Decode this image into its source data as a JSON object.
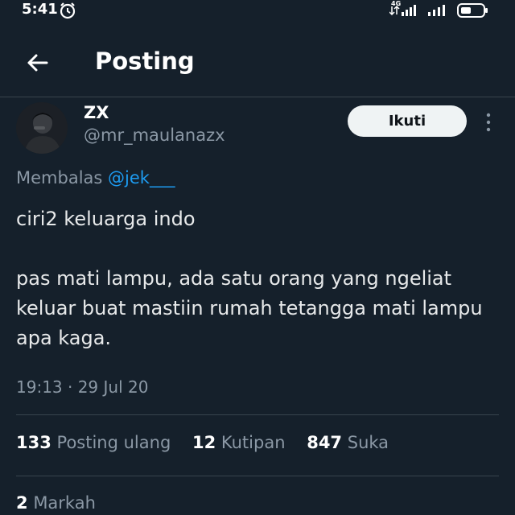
{
  "status_bar": {
    "time": "5:41",
    "network": "4G",
    "icons": [
      "alarm-icon",
      "signal-icon",
      "signal-icon",
      "battery-icon"
    ]
  },
  "header": {
    "title": "Posting",
    "back_icon": "arrow-left-icon"
  },
  "post": {
    "author": {
      "display_name": "ZX",
      "handle": "@mr_maulanazx"
    },
    "follow_label": "Ikuti",
    "more_icon": "vertical-ellipsis-icon",
    "reply_prefix": "Membalas",
    "reply_to": "@jek___",
    "text_lines": [
      "ciri2 keluarga indo",
      "pas mati lampu, ada satu orang yang ngeliat keluar buat mastiin rumah tetangga mati lampu apa kaga."
    ],
    "timestamp": "19:13 · 29 Jul 20"
  },
  "stats": {
    "reposts": {
      "count": "133",
      "label": "Posting ulang"
    },
    "quotes": {
      "count": "12",
      "label": "Kutipan"
    },
    "likes": {
      "count": "847",
      "label": "Suka"
    },
    "bookmarks": {
      "count": "2",
      "label": "Markah"
    }
  },
  "colors": {
    "background": "#15202b",
    "divider": "#38444d",
    "secondary_text": "#8b98a5",
    "link": "#1d9bf0",
    "follow_button_bg": "#eff3f4"
  }
}
